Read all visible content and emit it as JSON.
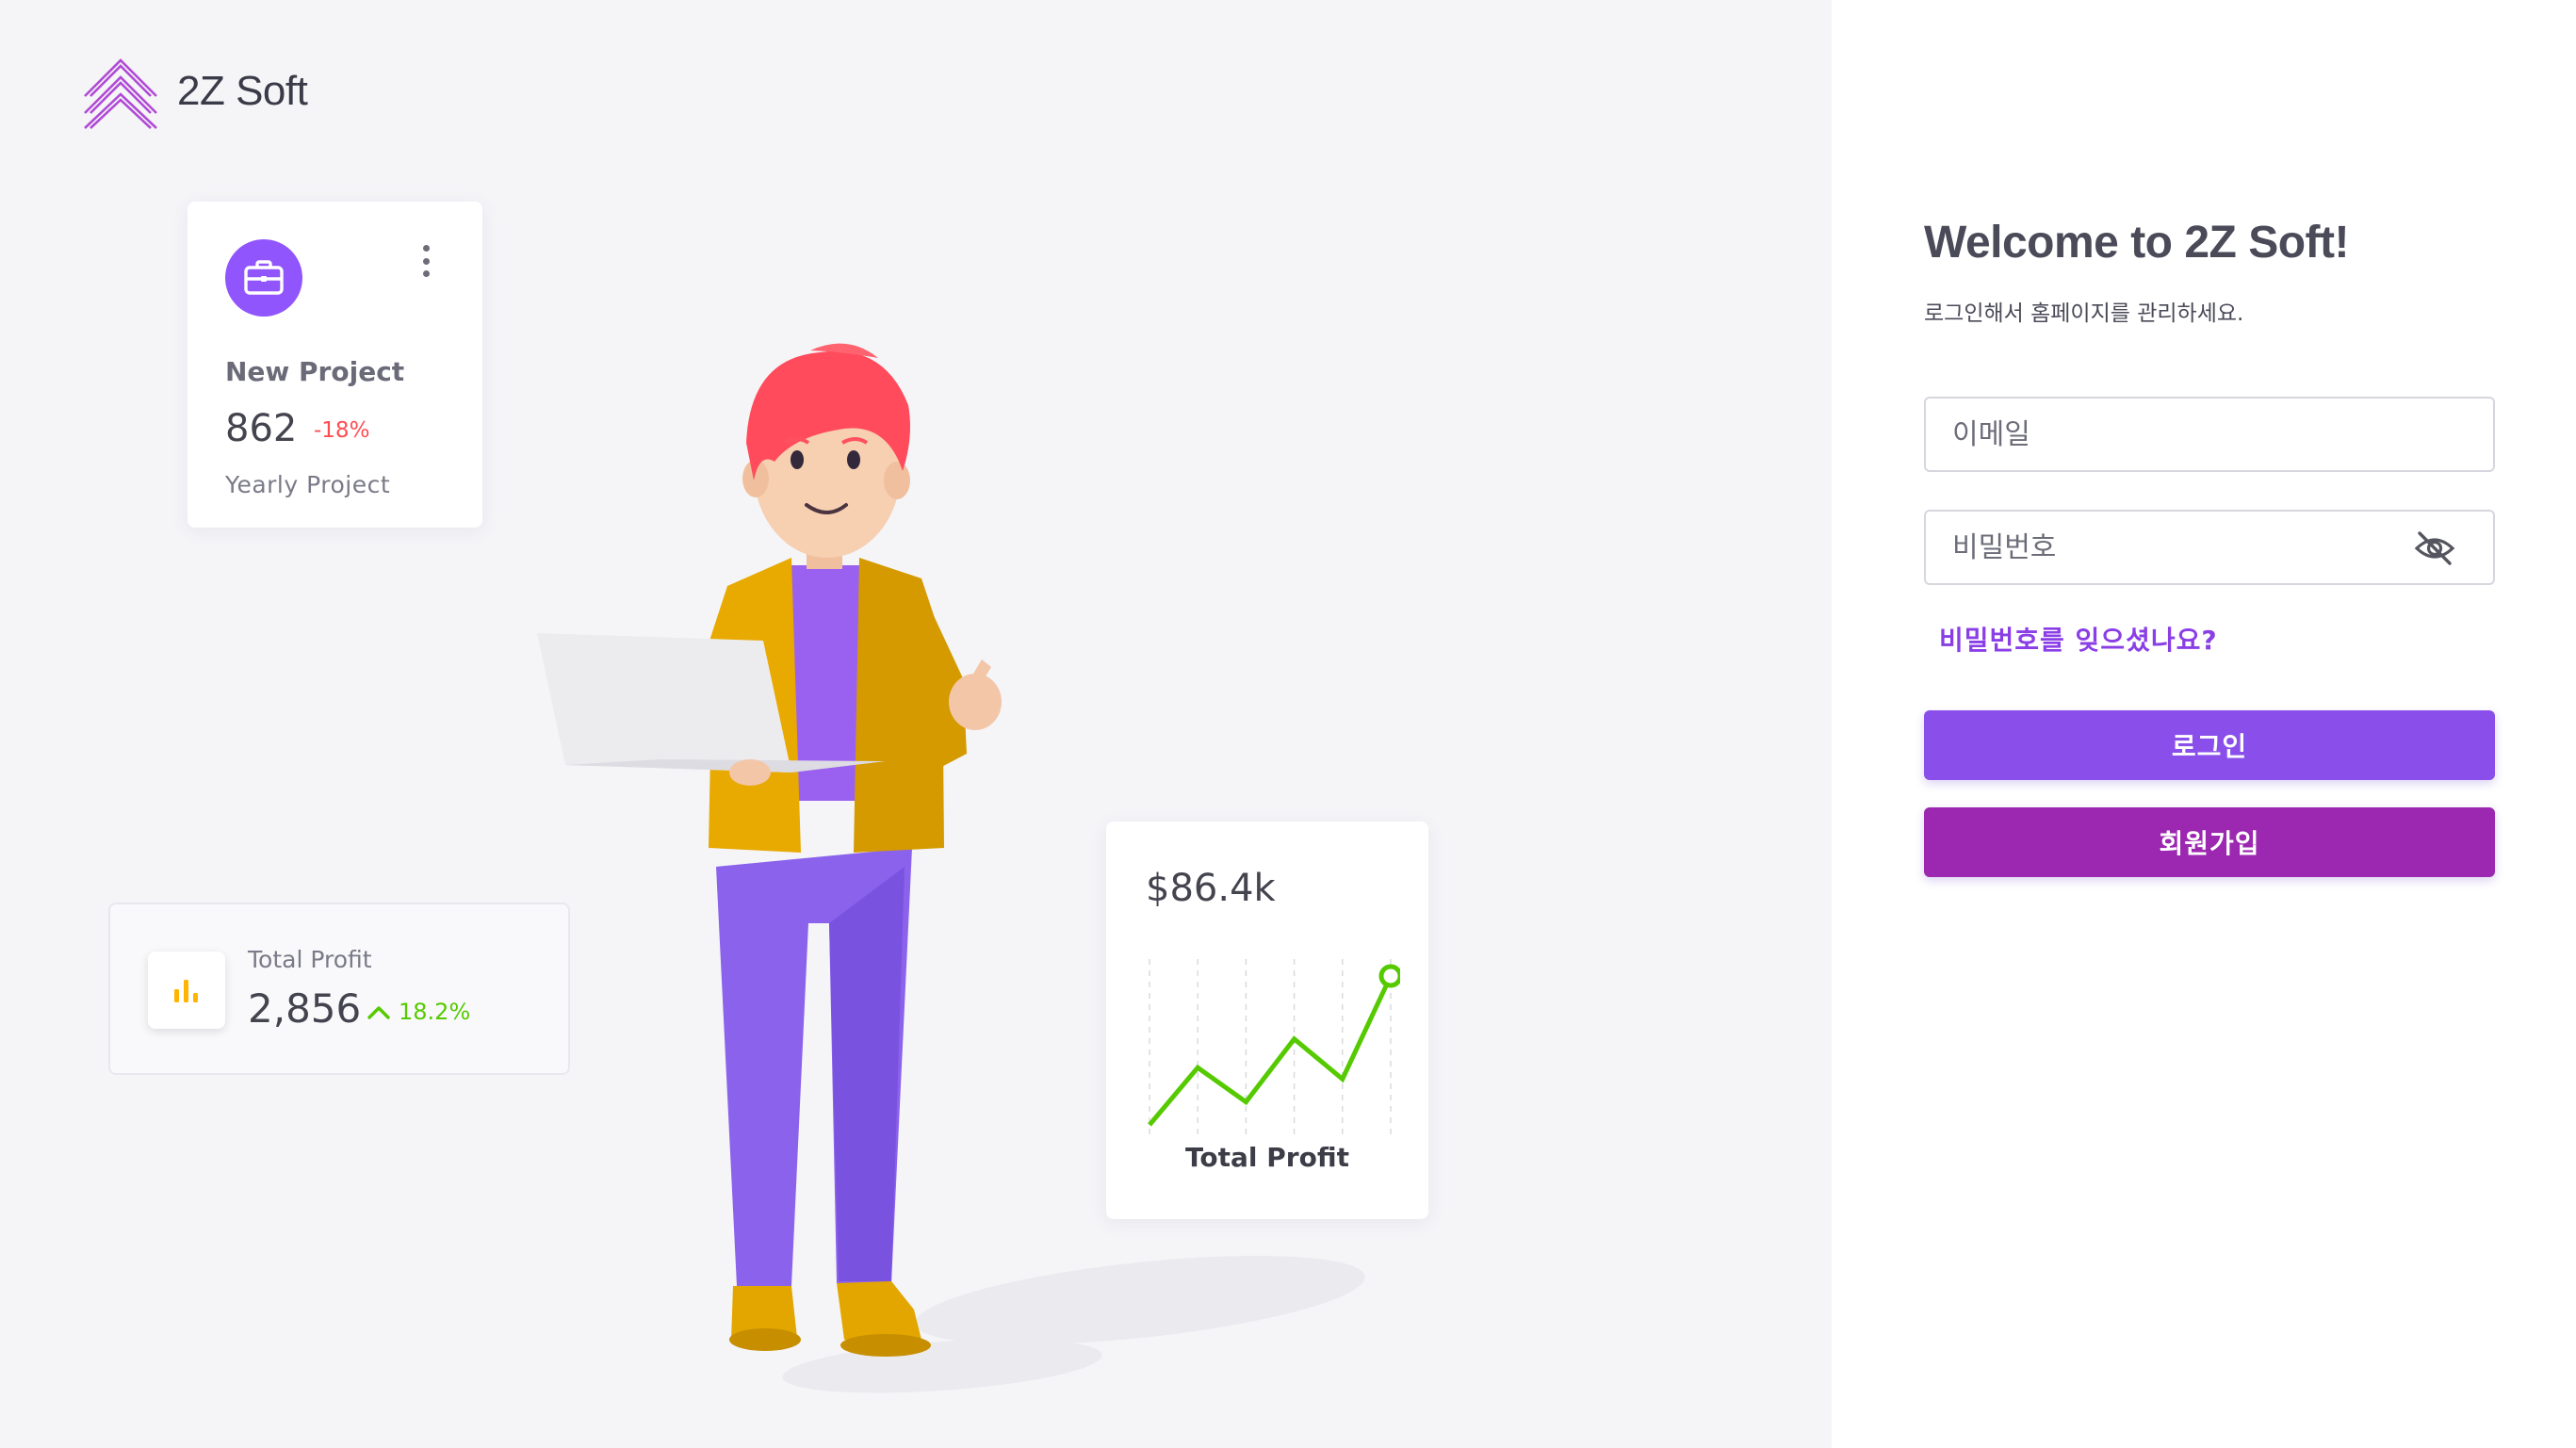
{
  "brand": {
    "name": "2Z Soft",
    "logo_color": "#b04bd6"
  },
  "cards": {
    "project": {
      "icon": "briefcase-icon",
      "title": "New Project",
      "value": "862",
      "delta": "-18%",
      "subtitle": "Yearly Project"
    },
    "total_profit_small": {
      "icon": "bar-chart-icon",
      "label": "Total Profit",
      "value": "2,856",
      "delta": "18.2%"
    },
    "total_profit_chart": {
      "value": "$86.4k",
      "label": "Total Profit"
    }
  },
  "chart_data": {
    "type": "line",
    "x": [
      0,
      1,
      2,
      3,
      4,
      5
    ],
    "values": [
      0,
      2,
      0.8,
      3,
      1.6,
      5.2
    ],
    "color": "#56ca00",
    "grid": "vertical-dashed"
  },
  "login": {
    "title": "Welcome to 2Z Soft!",
    "subtitle": "로그인해서 홈페이지를 관리하세요.",
    "email_placeholder": "이메일",
    "password_placeholder": "비밀번호",
    "password_toggle_icon": "eye-off-icon",
    "forgot_password": "비밀번호를 잊으셨나요?",
    "login_button": "로그인",
    "signup_button": "회원가입"
  },
  "colors": {
    "primary": "#8a4fea",
    "secondary": "#9c27b0",
    "success": "#56ca00",
    "error": "#ff4c51"
  }
}
